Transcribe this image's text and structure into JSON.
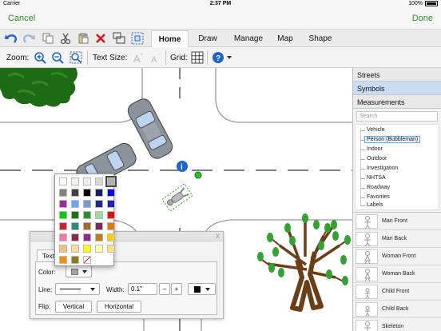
{
  "status": {
    "carrier": "Carrier",
    "time": "2:37 PM",
    "battery": "100%"
  },
  "nav": {
    "cancel": "Cancel",
    "done": "Done"
  },
  "toolbar": {
    "tools": [
      "undo-icon",
      "redo-icon",
      "copy-icon",
      "cut-icon",
      "paste-icon",
      "delete-icon",
      "group-icon",
      "select-all-icon"
    ],
    "tabs": [
      "Home",
      "Draw",
      "Manage",
      "Map",
      "Shape"
    ],
    "active_tab": "Home"
  },
  "subtoolbar": {
    "zoom_label": "Zoom:",
    "text_size_label": "Text Size:",
    "grid_label": "Grid:"
  },
  "sidepanel": {
    "tabs": [
      "Streets",
      "Symbols",
      "Measurements"
    ],
    "active_tab": "Symbols",
    "search_placeholder": "Search",
    "tree": [
      "Vehicle",
      "Person (Bubbleman)",
      "Indoor",
      "Outdoor",
      "Investigation",
      "NHTSA",
      "Roadway",
      "Favorites",
      "Labels"
    ],
    "selected_tree_item": "Person (Bubbleman)",
    "symbols": [
      "Man Front",
      "Man Back",
      "Woman Front",
      "Woman Back",
      "Child Front",
      "Child Back",
      "Skeleton"
    ]
  },
  "panel": {
    "tab": "Text",
    "color_label": "Color:",
    "line_label": "Line:",
    "width_label": "Width:",
    "width_value": "0.1\"",
    "minus": "−",
    "plus": "+",
    "flip_label": "Flip:",
    "vertical": "Vertical",
    "horizontal": "Horizontal",
    "close": "x"
  },
  "palette": [
    [
      "#ffffff",
      "#f7f0e6",
      "#eeeeee",
      "#d8d8d8",
      "#b0b0b0"
    ],
    [
      "#808080",
      "#404040",
      "#000000",
      "#1a1a66",
      "#0000ff"
    ],
    [
      "#9b2d9b",
      "#66aaff",
      "#7799cc",
      "#1a2a80",
      "#2222aa"
    ],
    [
      "#00cc00",
      "#1e6e1e",
      "#2d8c2d",
      "#a0d8a0",
      "#e01010"
    ],
    [
      "#cc2233",
      "#2a8c7a",
      "#a26a2a",
      "#7a2a5a",
      "#e07a10"
    ],
    [
      "#ff77aa",
      "#8a2a4a",
      "#8a2a8a",
      "#c07a20",
      "#ffd000"
    ],
    [
      "#f4c080",
      "#ffdd99",
      "#ffff00",
      "#ffffaa",
      "#ffe080"
    ],
    [
      "#ff8c00",
      "#8a7a20",
      "none"
    ]
  ],
  "palette_selected": "#b0b0b0",
  "colors": {
    "accent": "#2e8b2e",
    "toolbar_blue": "#1f66c8",
    "delete_red": "#cc1f1f"
  }
}
